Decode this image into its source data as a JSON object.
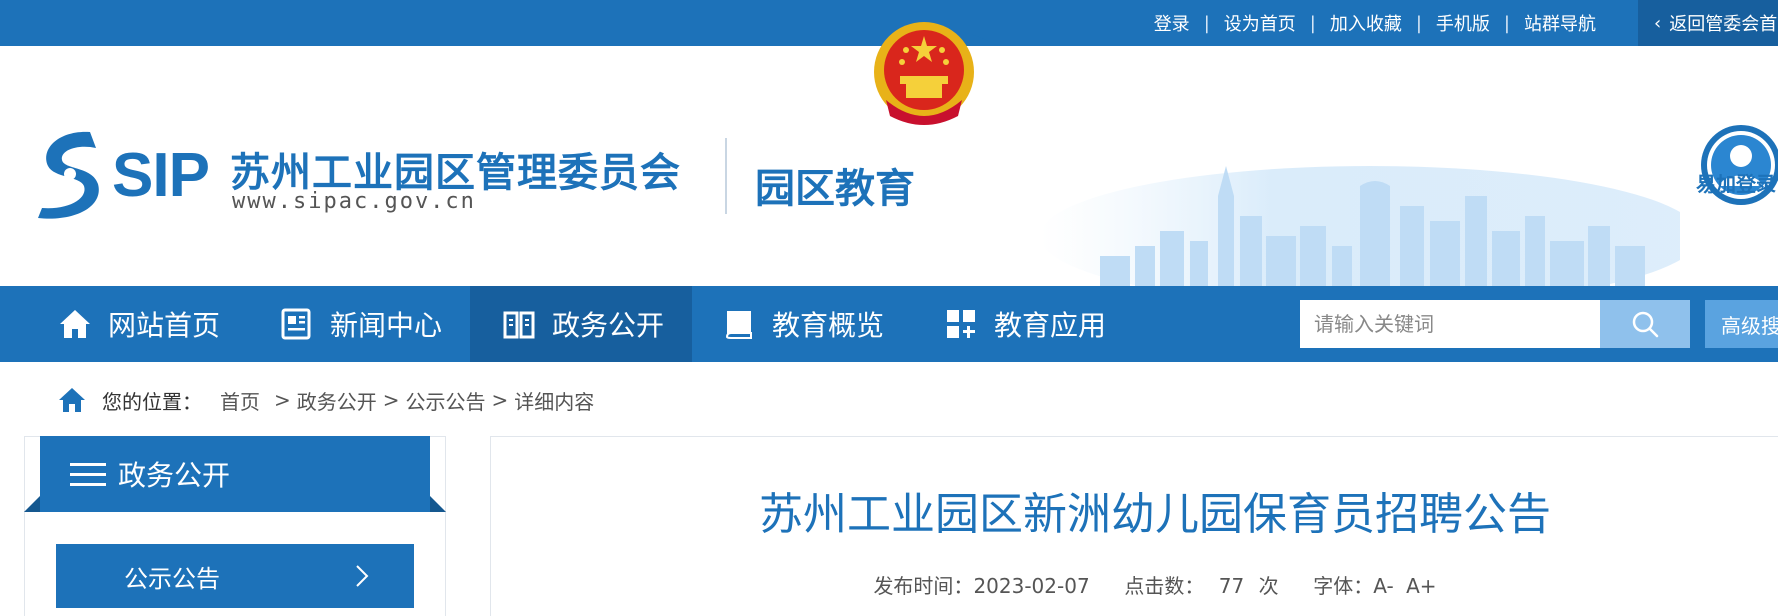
{
  "topbar": {
    "links": [
      "登录",
      "设为首页",
      "加入收藏",
      "手机版",
      "站群导航"
    ],
    "separator": "|",
    "back_label": "返回管委会首页"
  },
  "header": {
    "logo_text": "SIP",
    "org_name": "苏州工业园区管理委员会",
    "org_url": "www.sipac.gov.cn",
    "site_name": "园区教育",
    "login_label": "易加登录"
  },
  "nav": {
    "items": [
      {
        "label": "网站首页",
        "icon": "home-icon"
      },
      {
        "label": "新闻中心",
        "icon": "newspaper-icon"
      },
      {
        "label": "政务公开",
        "icon": "open-book-icon"
      },
      {
        "label": "教育概览",
        "icon": "book-icon"
      },
      {
        "label": "教育应用",
        "icon": "apps-grid-icon"
      }
    ],
    "active_index": 2,
    "search_placeholder": "请输入关键词",
    "advanced_label": "高级搜索"
  },
  "breadcrumb": {
    "label": "您的位置：",
    "items": [
      "首页",
      "政务公开",
      "公示公告",
      "详细内容"
    ],
    "separator": ">"
  },
  "sidebar": {
    "title": "政务公开",
    "items": [
      {
        "label": "公示公告"
      }
    ]
  },
  "article": {
    "title": "苏州工业园区新洲幼儿园保育员招聘公告",
    "publish_label": "发布时间：",
    "publish_date": "2023-02-07",
    "clicks_label": "点击数：",
    "clicks_value": "77",
    "clicks_unit": "次",
    "font_label": "字体：",
    "font_small": "A-",
    "font_large": "A+"
  },
  "colors": {
    "primary": "#1d72b9",
    "primary_dark": "#175f9e",
    "search_button": "#8fc1ec",
    "title_blue": "#1d72b9"
  }
}
